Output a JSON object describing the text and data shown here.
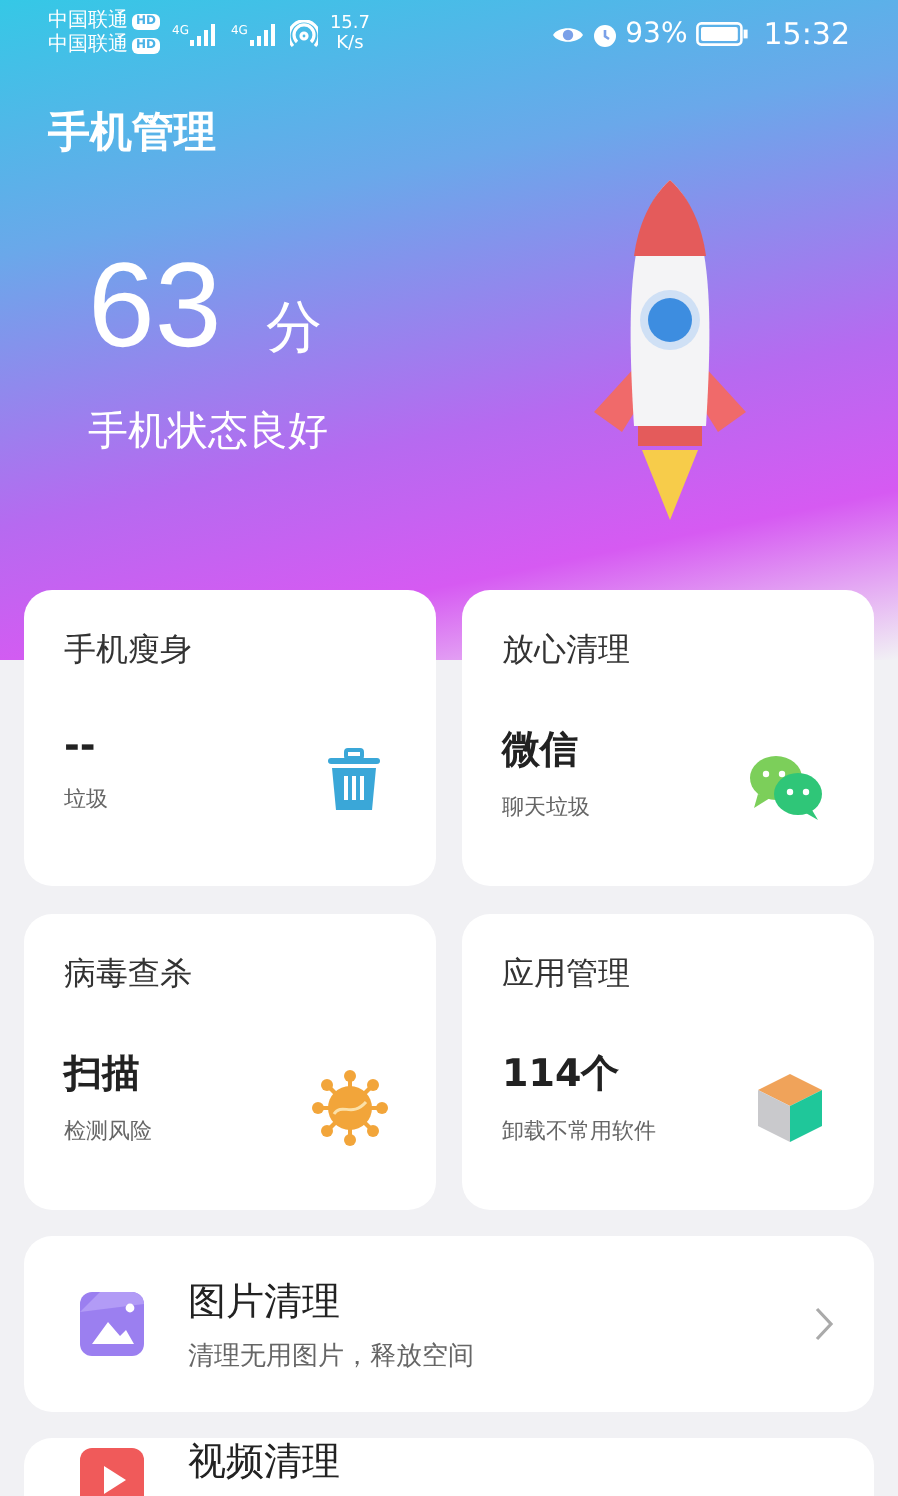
{
  "status_bar": {
    "carriers": [
      {
        "name": "中国联通",
        "badge": "HD"
      },
      {
        "name": "中国联通",
        "badge": "HD"
      }
    ],
    "signals": [
      {
        "label": "4G"
      },
      {
        "label": "4G"
      }
    ],
    "speed": [
      "15.7",
      "K/s"
    ],
    "battery": "93%",
    "time": "15:32"
  },
  "header": {
    "title": "手机管理",
    "score": "63",
    "unit": "分",
    "status": "手机状态良好"
  },
  "cards": [
    {
      "title": "手机瘦身",
      "value": "--",
      "caption": "垃圾",
      "kind": "trash"
    },
    {
      "title": "放心清理",
      "value": "微信",
      "caption": "聊天垃圾",
      "kind": "chat"
    },
    {
      "title": "病毒查杀",
      "value": "扫描",
      "caption": "检测风险",
      "kind": "virus"
    },
    {
      "title": "应用管理",
      "value": "114个",
      "caption": "卸载不常用软件",
      "kind": "cube"
    }
  ],
  "list": [
    {
      "title": "图片清理",
      "subtitle": "清理无用图片，释放空间",
      "kind": "picture"
    },
    {
      "title": "视频清理",
      "kind": "video"
    }
  ]
}
